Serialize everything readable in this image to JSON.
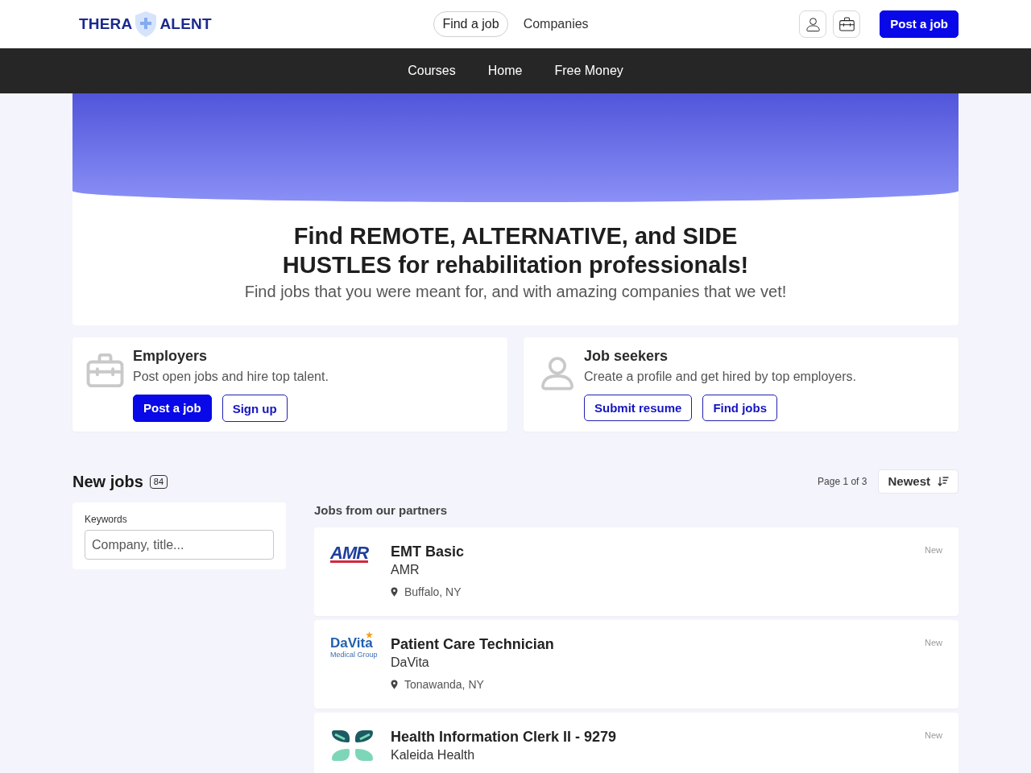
{
  "header": {
    "logo": {
      "left": "THERA",
      "right": "ALENT"
    },
    "nav": [
      {
        "label": "Find a job",
        "selected": true
      },
      {
        "label": "Companies",
        "selected": false
      }
    ],
    "post_button": "Post a job"
  },
  "subnav": [
    "Courses",
    "Home",
    "Free Money"
  ],
  "hero": {
    "title": "Find REMOTE, ALTERNATIVE, and SIDE HUSTLES for rehabilitation professionals!",
    "subtitle": "Find jobs that you were meant for, and with amazing companies that we vet!"
  },
  "audiences": [
    {
      "kind": "employers",
      "title": "Employers",
      "text": "Post open jobs and hire top talent.",
      "buttons": [
        {
          "label": "Post a job",
          "kind": "primary"
        },
        {
          "label": "Sign up",
          "kind": "outline"
        }
      ]
    },
    {
      "kind": "seekers",
      "title": "Job seekers",
      "text": "Create a profile and get hired by top employers.",
      "buttons": [
        {
          "label": "Submit resume",
          "kind": "outline"
        },
        {
          "label": "Find jobs",
          "kind": "outline"
        }
      ]
    }
  ],
  "jobs_section": {
    "title": "New jobs",
    "count": "84",
    "pagination": "Page 1 of 3",
    "sort": "Newest",
    "filter": {
      "label": "Keywords",
      "placeholder": "Company, title..."
    },
    "partners_heading": "Jobs from our partners",
    "jobs": [
      {
        "logo": {
          "kind": "amr",
          "text": "AMR"
        },
        "title": "EMT Basic",
        "company": "AMR",
        "location": "Buffalo, NY",
        "badge": "New"
      },
      {
        "logo": {
          "kind": "davita",
          "text": "DaVita",
          "subtext": "Medical Group"
        },
        "title": "Patient Care Technician",
        "company": "DaVita",
        "location": "Tonawanda, NY",
        "badge": "New"
      },
      {
        "logo": {
          "kind": "kaleida"
        },
        "title": "Health Information Clerk II - 9279",
        "company": "Kaleida Health",
        "badge": "New"
      }
    ]
  }
}
